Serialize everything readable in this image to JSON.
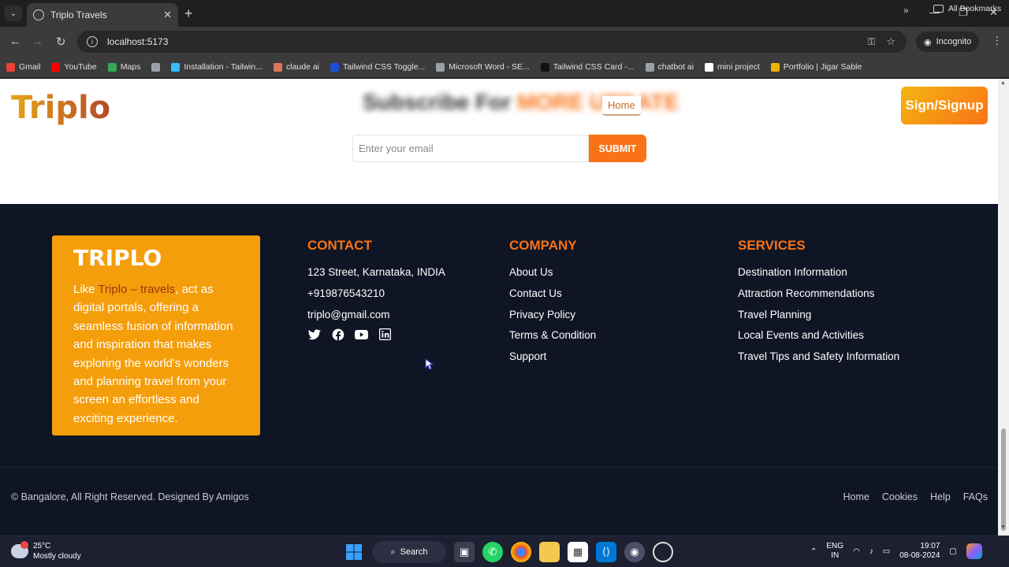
{
  "browser": {
    "tab_title": "Triplo Travels",
    "tab_close": "✕",
    "new_tab": "+",
    "tab_list": "⌄",
    "url": "localhost:5173",
    "incognito_label": "Incognito",
    "window_minimize": "—",
    "window_restore": "❐",
    "window_close": "✕",
    "back": "←",
    "forward": "→",
    "reload": "↻",
    "bookmarks": [
      {
        "label": "Gmail",
        "color": "#ea4335"
      },
      {
        "label": "YouTube",
        "color": "#ff0000"
      },
      {
        "label": "Maps",
        "color": "#34a853"
      },
      {
        "label": "",
        "color": "#9aa0a6"
      },
      {
        "label": "Installation - Tailwin...",
        "color": "#38bdf8"
      },
      {
        "label": "claude ai",
        "color": "#d97757"
      },
      {
        "label": "Tailwind CSS Toggle...",
        "color": "#1d4ed8"
      },
      {
        "label": "Microsoft Word - SE...",
        "color": "#9aa0a6"
      },
      {
        "label": "Tailwind CSS Card -...",
        "color": "#111111"
      },
      {
        "label": "chatbot ai",
        "color": "#9aa0a6"
      },
      {
        "label": "mini project",
        "color": "#ffffff"
      },
      {
        "label": "Portfolio | Jigar Sable",
        "color": "#eab308"
      }
    ],
    "bookmarks_more": "»",
    "all_bookmarks": "All Bookmarks"
  },
  "header": {
    "logo": "Triplo",
    "subscribe_heading": "Subscribe For",
    "subscribe_accent": "MORE UPDATE",
    "nav_home": "Home",
    "signup_label": "Sign/Signup"
  },
  "newsletter": {
    "placeholder": "Enter your email",
    "submit_label": "SUBMIT"
  },
  "footer": {
    "brand_title": "TRIPLO",
    "brand_desc_pre": "Like ",
    "brand_desc_highlight": "Triplo – travels",
    "brand_desc_post": ", act as digital portals, offering a seamless fusion of information and inspiration that makes exploring the world's wonders and planning travel from your screen an effortless and exciting experience.",
    "contact": {
      "title": "CONTACT",
      "items": [
        "123 Street, Karnataka, INDIA",
        "+919876543210",
        "triplo@gmail.com"
      ]
    },
    "company": {
      "title": "COMPANY",
      "items": [
        "About Us",
        "Contact Us",
        "Privacy Policy",
        "Terms & Condition",
        "Support"
      ]
    },
    "services": {
      "title": "SERVICES",
      "items": [
        "Destination Information",
        "Attraction Recommendations",
        "Travel Planning",
        "Local Events and Activities",
        "Travel Tips and Safety Information"
      ]
    },
    "copyright": "© Bangalore, All Right Reserved. Designed By Amigos",
    "bottom_links": [
      "Home",
      "Cookies",
      "Help",
      "FAQs"
    ]
  },
  "taskbar": {
    "weather_temp": "25°C",
    "weather_desc": "Mostly cloudy",
    "weather_badge": "1",
    "search_label": "Search",
    "lang_top": "ENG",
    "lang_bottom": "IN",
    "time": "19:07",
    "date": "08-08-2024"
  },
  "colors": {
    "accent": "#f97316",
    "brand_card": "#f59e0b",
    "footer_bg": "#0f1524"
  }
}
